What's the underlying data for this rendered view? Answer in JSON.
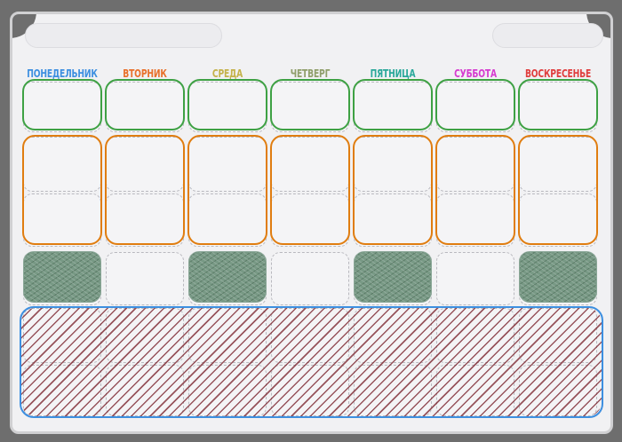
{
  "days": [
    {
      "label": "ПОНЕДЕЛЬНИК",
      "color": "#3d8fe0"
    },
    {
      "label": "ВТОРНИК",
      "color": "#e8702a"
    },
    {
      "label": "СРЕДА",
      "color": "#c4b24a"
    },
    {
      "label": "ЧЕТВЕРГ",
      "color": "#8f9e6a"
    },
    {
      "label": "ПЯТНИЦА",
      "color": "#2aa89a"
    },
    {
      "label": "СУББОТА",
      "color": "#d63bd0"
    },
    {
      "label": "ВОСКРЕСЕНЬЕ",
      "color": "#e03d3d"
    }
  ],
  "colors": {
    "green_outline": "#3ea144",
    "orange_outline": "#e07d10",
    "blue_outline": "#3d8fe0",
    "green_hatch": "#789985",
    "red_hatch": "#7a1e28"
  }
}
